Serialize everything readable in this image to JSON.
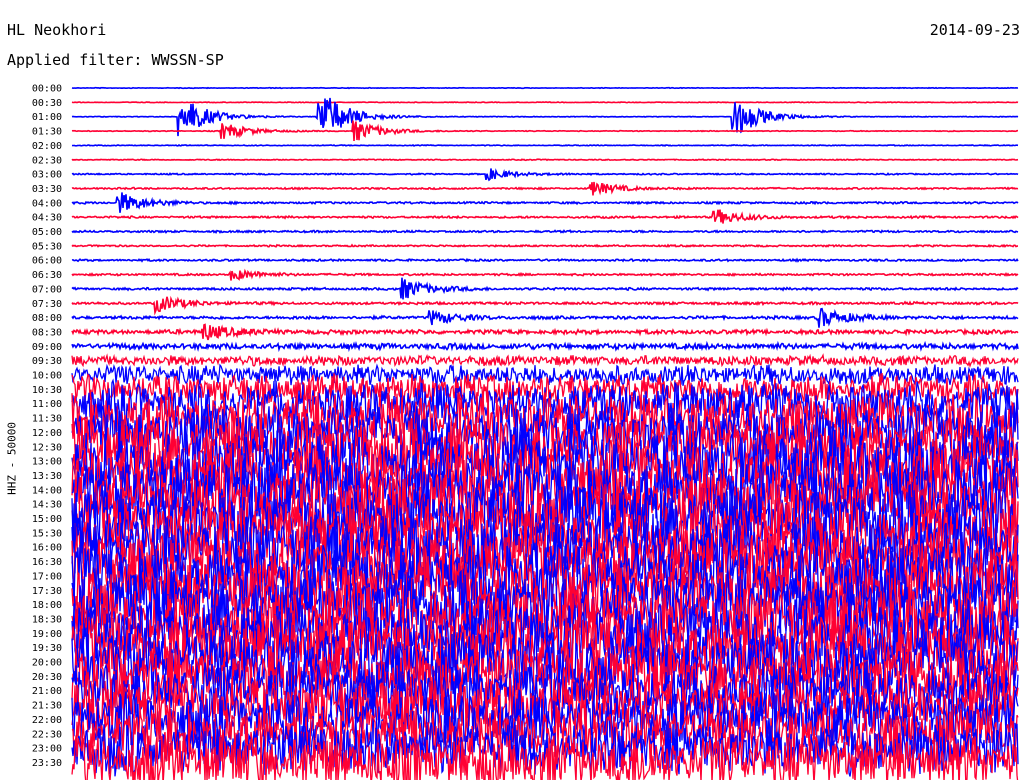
{
  "header": {
    "station": "HL Neokhori",
    "date": "2014-09-23",
    "filter_label": "Applied filter: WWSSN-SP"
  },
  "axis": {
    "ylabel": "HHZ - 50000"
  },
  "colors": {
    "trace_a": "#0000ff",
    "trace_b": "#ff0033",
    "background": "#ffffff"
  },
  "chart_data": {
    "type": "line",
    "title": "",
    "ylabel": "HHZ - 50000",
    "series_colors": [
      "#0000ff",
      "#ff0033"
    ],
    "rows": [
      {
        "label": "00:00",
        "noise": 0.04
      },
      {
        "label": "00:30",
        "noise": 0.04
      },
      {
        "label": "01:00",
        "noise": 0.04
      },
      {
        "label": "01:30",
        "noise": 0.05
      },
      {
        "label": "02:00",
        "noise": 0.05
      },
      {
        "label": "02:30",
        "noise": 0.06
      },
      {
        "label": "03:00",
        "noise": 0.08
      },
      {
        "label": "03:30",
        "noise": 0.1
      },
      {
        "label": "04:00",
        "noise": 0.12
      },
      {
        "label": "04:30",
        "noise": 0.12
      },
      {
        "label": "05:00",
        "noise": 0.12
      },
      {
        "label": "05:30",
        "noise": 0.1
      },
      {
        "label": "06:00",
        "noise": 0.12
      },
      {
        "label": "06:30",
        "noise": 0.12
      },
      {
        "label": "07:00",
        "noise": 0.14
      },
      {
        "label": "07:30",
        "noise": 0.15
      },
      {
        "label": "08:00",
        "noise": 0.18
      },
      {
        "label": "08:30",
        "noise": 0.25
      },
      {
        "label": "09:00",
        "noise": 0.35
      },
      {
        "label": "09:30",
        "noise": 0.6
      },
      {
        "label": "10:00",
        "noise": 1.2
      },
      {
        "label": "10:30",
        "noise": 1.8
      },
      {
        "label": "11:00",
        "noise": 2.5
      },
      {
        "label": "11:30",
        "noise": 3
      },
      {
        "label": "12:00",
        "noise": 3.4
      },
      {
        "label": "12:30",
        "noise": 3.6
      },
      {
        "label": "13:00",
        "noise": 3.8
      },
      {
        "label": "13:30",
        "noise": 4
      },
      {
        "label": "14:00",
        "noise": 4
      },
      {
        "label": "14:30",
        "noise": 4
      },
      {
        "label": "15:00",
        "noise": 4
      },
      {
        "label": "15:30",
        "noise": 4
      },
      {
        "label": "16:00",
        "noise": 4
      },
      {
        "label": "16:30",
        "noise": 4
      },
      {
        "label": "17:00",
        "noise": 4
      },
      {
        "label": "17:30",
        "noise": 4
      },
      {
        "label": "18:00",
        "noise": 4
      },
      {
        "label": "18:30",
        "noise": 4
      },
      {
        "label": "19:00",
        "noise": 4
      },
      {
        "label": "19:30",
        "noise": 4
      },
      {
        "label": "20:00",
        "noise": 3.8
      },
      {
        "label": "20:30",
        "noise": 3.6
      },
      {
        "label": "21:00",
        "noise": 3.5
      },
      {
        "label": "21:30",
        "noise": 3.4
      },
      {
        "label": "22:00",
        "noise": 3.3
      },
      {
        "label": "22:30",
        "noise": 3.2
      },
      {
        "label": "23:00",
        "noise": 3.2
      },
      {
        "label": "23:30",
        "noise": 3.2
      }
    ],
    "events": [
      {
        "row": "01:00",
        "t": 0.115,
        "amp": 3.2
      },
      {
        "row": "01:30",
        "t": 0.16,
        "amp": 1.2
      },
      {
        "row": "01:00",
        "t": 0.26,
        "amp": 4.5
      },
      {
        "row": "01:30",
        "t": 0.3,
        "amp": 1.5
      },
      {
        "row": "01:00",
        "t": 0.7,
        "amp": 3.0
      },
      {
        "row": "03:00",
        "t": 0.44,
        "amp": 0.8
      },
      {
        "row": "03:30",
        "t": 0.55,
        "amp": 1.0
      },
      {
        "row": "04:00",
        "t": 0.05,
        "amp": 1.6
      },
      {
        "row": "04:30",
        "t": 0.68,
        "amp": 1.2
      },
      {
        "row": "06:30",
        "t": 0.17,
        "amp": 0.8
      },
      {
        "row": "07:00",
        "t": 0.35,
        "amp": 1.5
      },
      {
        "row": "07:30",
        "t": 0.09,
        "amp": 1.2
      },
      {
        "row": "08:00",
        "t": 0.38,
        "amp": 1.0
      },
      {
        "row": "08:00",
        "t": 0.79,
        "amp": 1.4
      },
      {
        "row": "08:30",
        "t": 0.14,
        "amp": 1.2
      }
    ]
  }
}
